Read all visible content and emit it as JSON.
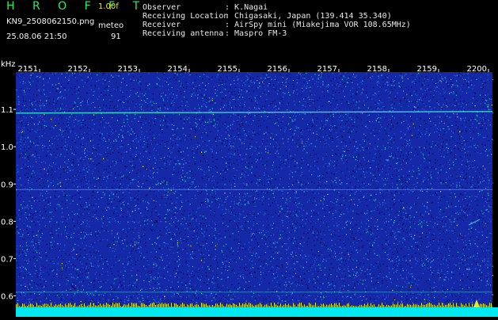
{
  "header": {
    "logo": "H R O F F T",
    "version": "1.00f",
    "filename": "KN9_2508062150.png",
    "meteo_label": "meteo",
    "datetime": "25.08.06 21:50",
    "meteo_count": "91"
  },
  "station": [
    {
      "key": "Observer",
      "value": ": K.Nagai"
    },
    {
      "key": "Receiving Location",
      "value": ": Chigasaki, Japan (139.414 35.340)"
    },
    {
      "key": "Receiver",
      "value": ": AirSpy mini (Miakejima VOR 108.65MHz)"
    },
    {
      "key": "Receiving antenna",
      "value": ": Maspro FM-3"
    }
  ],
  "spectrogram": {
    "unit_label": "kHz",
    "time_ticks": [
      "2151",
      "2152",
      "2153",
      "2154",
      "2155",
      "2156",
      "2157",
      "2158",
      "2159",
      "2200"
    ],
    "freq_ticks": [
      {
        "label": "1.1",
        "value": 1.1
      },
      {
        "label": "1.0",
        "value": 1.0
      },
      {
        "label": "0.9",
        "value": 0.9
      },
      {
        "label": "0.8",
        "value": 0.8
      },
      {
        "label": "0.7",
        "value": 0.7
      },
      {
        "label": "0.6",
        "value": 0.6
      }
    ],
    "freq_range": [
      0.565,
      1.2
    ],
    "carrier_freqs": [
      1.09,
      0.885,
      0.61
    ],
    "colors": {
      "background": "#1428a8",
      "noise_dark": "#0a0a50",
      "noise_mid": "#1e6ad8",
      "noise_bright": "#2cc8c8",
      "noise_hot": "#e8e81e",
      "carrier": "#3ce8d0",
      "grid": "#4a6ae0",
      "floor_bar": "#00e8f0",
      "floor_spikes": "#e8e81e"
    }
  }
}
